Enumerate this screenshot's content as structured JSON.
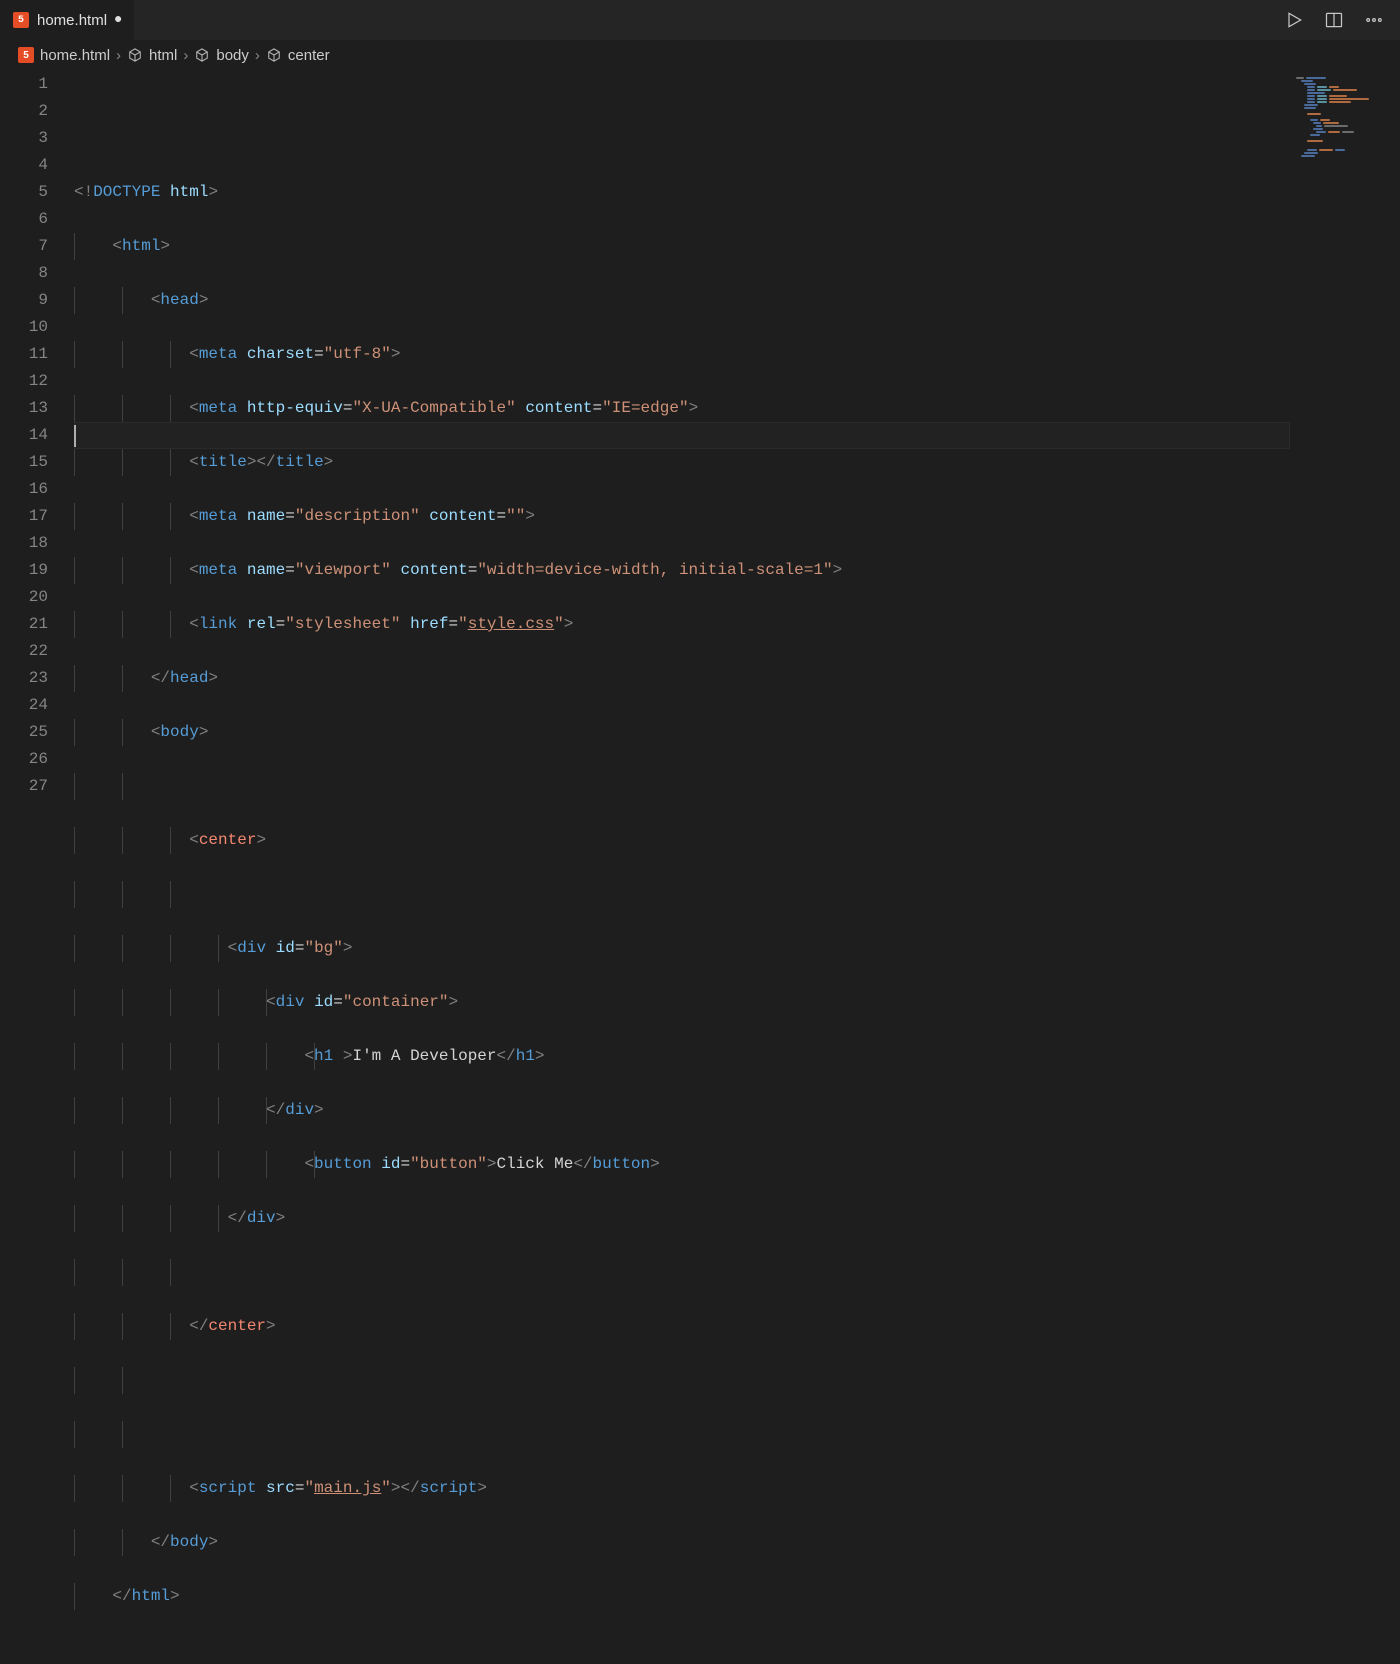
{
  "tab": {
    "filename": "home.html",
    "dirty": true
  },
  "breadcrumb": {
    "file": "home.html",
    "path": [
      "html",
      "body",
      "center"
    ]
  },
  "toolbar": {
    "run": "Run",
    "split": "Split Editor",
    "more": "More Actions"
  },
  "gutter": {
    "lines": [
      "1",
      "2",
      "3",
      "4",
      "5",
      "6",
      "7",
      "8",
      "9",
      "10",
      "11",
      "12",
      "13",
      "14",
      "15",
      "16",
      "17",
      "18",
      "19",
      "20",
      "21",
      "22",
      "23",
      "24",
      "25",
      "26",
      "27"
    ]
  },
  "code": {
    "l1": {
      "doctype": "DOCTYPE",
      "html": "html"
    },
    "l2": {
      "tag": "html"
    },
    "l3": {
      "tag": "head"
    },
    "l4": {
      "tag": "meta",
      "attr1": "charset",
      "val1": "\"utf-8\""
    },
    "l5": {
      "tag": "meta",
      "attr1": "http-equiv",
      "val1": "\"X-UA-Compatible\"",
      "attr2": "content",
      "val2": "\"IE=edge\""
    },
    "l6": {
      "open": "title",
      "close": "title"
    },
    "l7": {
      "tag": "meta",
      "attr1": "name",
      "val1": "\"description\"",
      "attr2": "content",
      "val2": "\"\""
    },
    "l8": {
      "tag": "meta",
      "attr1": "name",
      "val1": "\"viewport\"",
      "attr2": "content",
      "val2": "\"width=device-width, initial-scale=1\""
    },
    "l9": {
      "tag": "link",
      "attr1": "rel",
      "val1": "\"stylesheet\"",
      "attr2": "href",
      "q": "\"",
      "link": "style.css"
    },
    "l10": {
      "tag": "head"
    },
    "l11": {
      "tag": "body"
    },
    "l13": {
      "tag": "center"
    },
    "l15": {
      "tag": "div",
      "attr1": "id",
      "val1": "\"bg\""
    },
    "l16": {
      "tag": "div",
      "attr1": "id",
      "val1": "\"container\""
    },
    "l17": {
      "tag": "h1",
      "text": "I'm A Developer"
    },
    "l18": {
      "tag": "div"
    },
    "l19": {
      "tag": "button",
      "attr1": "id",
      "val1": "\"button\"",
      "text": "Click Me"
    },
    "l20": {
      "tag": "div"
    },
    "l22": {
      "tag": "center"
    },
    "l25": {
      "tag": "script",
      "attr1": "src",
      "q": "\"",
      "link": "main.js",
      "close": "script"
    },
    "l26": {
      "tag": "body"
    },
    "l27": {
      "tag": "html"
    }
  }
}
